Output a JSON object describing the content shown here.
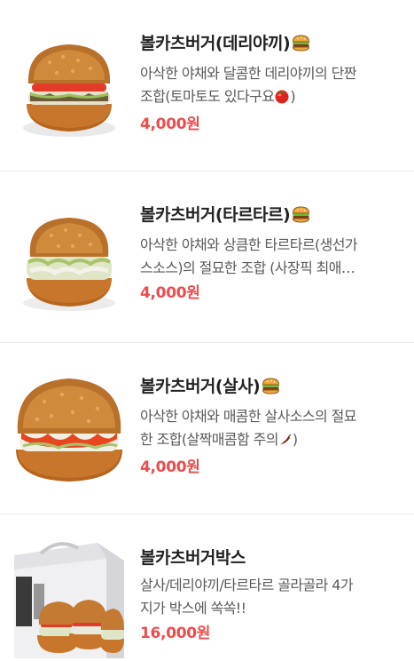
{
  "menu": {
    "items": [
      {
        "name": "볼카츠버거(데리야끼)",
        "desc_line1": "아삭한 야채와 달콤한 데리야끼의 단짠",
        "desc_line2": "조합(토마토도 있다구요",
        "desc_line2_end": ")",
        "price": "4,000원",
        "title_icon": "burger-emoji",
        "desc_icon": "tomato-emoji"
      },
      {
        "name": "볼카츠버거(타르타르)",
        "desc_line1": "아삭한 야채와 상큼한 타르타르(생선가",
        "desc_line2": "스소스)의 절묘한 조합 (사장픽 최애…",
        "price": "4,000원",
        "title_icon": "burger-emoji"
      },
      {
        "name": "볼카츠버거(살사)",
        "desc_line1": "아삭한 야채와 매콤한 살사소스의 절묘",
        "desc_line2": "한 조합(살짝매콤함 주의",
        "desc_line2_end": ")",
        "price": "4,000원",
        "title_icon": "burger-emoji",
        "desc_icon": "hot-pepper-emoji"
      },
      {
        "name": "볼카츠버거박스",
        "desc_line1": "살사/데리야끼/타르타르 골라골라 4가",
        "desc_line2": "지가 박스에 쏙쏙!!",
        "price": "16,000원"
      }
    ]
  },
  "colors": {
    "price": "#ef4b4b",
    "title": "#222222",
    "desc": "#5a5a5a",
    "divider": "#ececec"
  }
}
